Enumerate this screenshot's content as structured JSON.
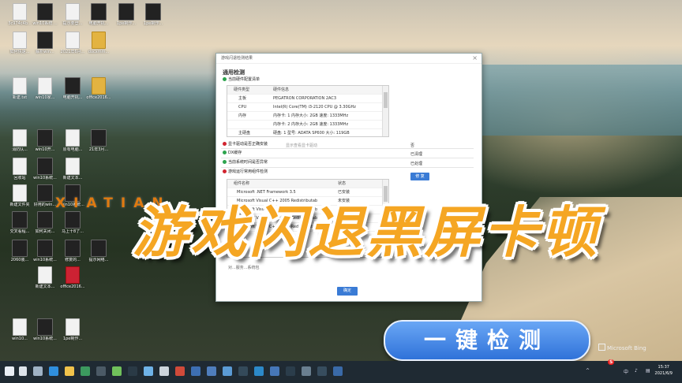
{
  "desktop_icons": [
    {
      "label": "3c974c4b...",
      "kind": "doc"
    },
    {
      "label": "win10系统 ...",
      "kind": "video"
    },
    {
      "label": "提示要登...",
      "kind": "doc"
    },
    {
      "label": "电脑开机...",
      "kind": "video"
    },
    {
      "label": "1pe制作...",
      "kind": "video"
    },
    {
      "label": "1pe制作...",
      "kind": "video"
    },
    {
      "label": "如何快速...",
      "kind": "doc"
    },
    {
      "label": "解析win...",
      "kind": "video"
    },
    {
      "label": "2021年6月...",
      "kind": "doc"
    },
    {
      "label": "docxmm...",
      "kind": "yellow"
    },
    {
      "label": "新建.txt",
      "kind": "doc"
    },
    {
      "label": "win10家...",
      "kind": "doc"
    },
    {
      "label": "电脑开机...",
      "kind": "video"
    },
    {
      "label": "office2016...",
      "kind": "yellow"
    },
    {
      "label": "消防队...",
      "kind": "doc"
    },
    {
      "label": "win10开...",
      "kind": "video"
    },
    {
      "label": "原有电脑...",
      "kind": "doc"
    },
    {
      "label": "21年3月...",
      "kind": "video"
    },
    {
      "label": "回收站",
      "kind": "doc"
    },
    {
      "label": "win10系统...",
      "kind": "video"
    },
    {
      "label": "新建文本...",
      "kind": "doc"
    },
    {
      "label": "新建文件夹",
      "kind": "doc"
    },
    {
      "label": "好用的win...",
      "kind": "video"
    },
    {
      "label": "win10系统...",
      "kind": "video"
    },
    {
      "label": "交叉看程...",
      "kind": "video"
    },
    {
      "label": "如何关闭...",
      "kind": "video"
    },
    {
      "label": "马上十8了...",
      "kind": "video"
    },
    {
      "label": "2060装...",
      "kind": "video"
    },
    {
      "label": "win10系统...",
      "kind": "video"
    },
    {
      "label": "修复的...",
      "kind": "video"
    },
    {
      "label": "提示网络...",
      "kind": "video"
    },
    {
      "label": "新建文本...",
      "kind": "doc"
    },
    {
      "label": "office2016...",
      "kind": "red"
    },
    {
      "label": "win10...",
      "kind": "doc"
    },
    {
      "label": "win10系统...",
      "kind": "video"
    },
    {
      "label": "1pe制作...",
      "kind": "doc"
    }
  ],
  "dialog": {
    "title": "游戏闪退检测结果",
    "section_heading": "通用检测",
    "hw_label": "当前硬件配置清单",
    "hw_table": {
      "headers": [
        "硬件类型",
        "硬件信息"
      ],
      "rows": [
        [
          "主板",
          "PEGATRON CORPORATION 2AC3"
        ],
        [
          "CPU",
          "Intel(R) Core(TM) i3-2120 CPU @ 3.30GHz"
        ],
        [
          "内存",
          "内存卡: 1 内存大小: 2GB 速度: 1333MHz"
        ],
        [
          "",
          "内存卡: 2 内存大小: 2GB 速度: 1333MHz"
        ],
        [
          "主硬盘",
          "硬盘: 1 型号: ADATA SP600 大小: 119GB"
        ]
      ]
    },
    "checks": [
      {
        "label": "显卡驱动是否正确安装",
        "status": "bad",
        "result": "否",
        "hint": "显示查看显卡驱动"
      },
      {
        "label": "DX缓存",
        "status": "ok",
        "result": "已清理"
      },
      {
        "label": "当前系统时间是否异常",
        "status": "ok",
        "result": "已处理"
      },
      {
        "label": "游戏运行常用组件检测",
        "status": "bad",
        "result": ""
      }
    ],
    "fix_label": "修 复",
    "comp_table": {
      "headers": [
        "组件名称",
        "状态"
      ],
      "rows": [
        [
          "Microsoft .NET Framework 3.5",
          "已安装"
        ],
        [
          "Microsoft Visual C++ 2005 Redistributab",
          "未安装"
        ],
        [
          "Microsoft Visual C++ 2008 Redistributab",
          "未安装"
        ],
        [
          "Microsoft Visual C++ 2010 Redistributab",
          "未安装"
        ],
        [
          "Microsoft Visual C++ 2012 Redistributab",
          "未安装"
        ]
      ]
    },
    "footer_note": "对...服务...系统包",
    "ok_label": "确定"
  },
  "overlay": {
    "brand": "XIATIAN",
    "headline": "游戏闪退黑屏卡顿",
    "pill": "一键检测",
    "watermark": "Microsoft Bing"
  },
  "taskbar": {
    "ime": "中",
    "ime_logo": "S",
    "time": "15:37",
    "date": "2021/6/9"
  },
  "colors": {
    "accent": "#f5a623",
    "button": "#3a7bd5",
    "ok": "#2da44e",
    "bad": "#d1242f"
  }
}
